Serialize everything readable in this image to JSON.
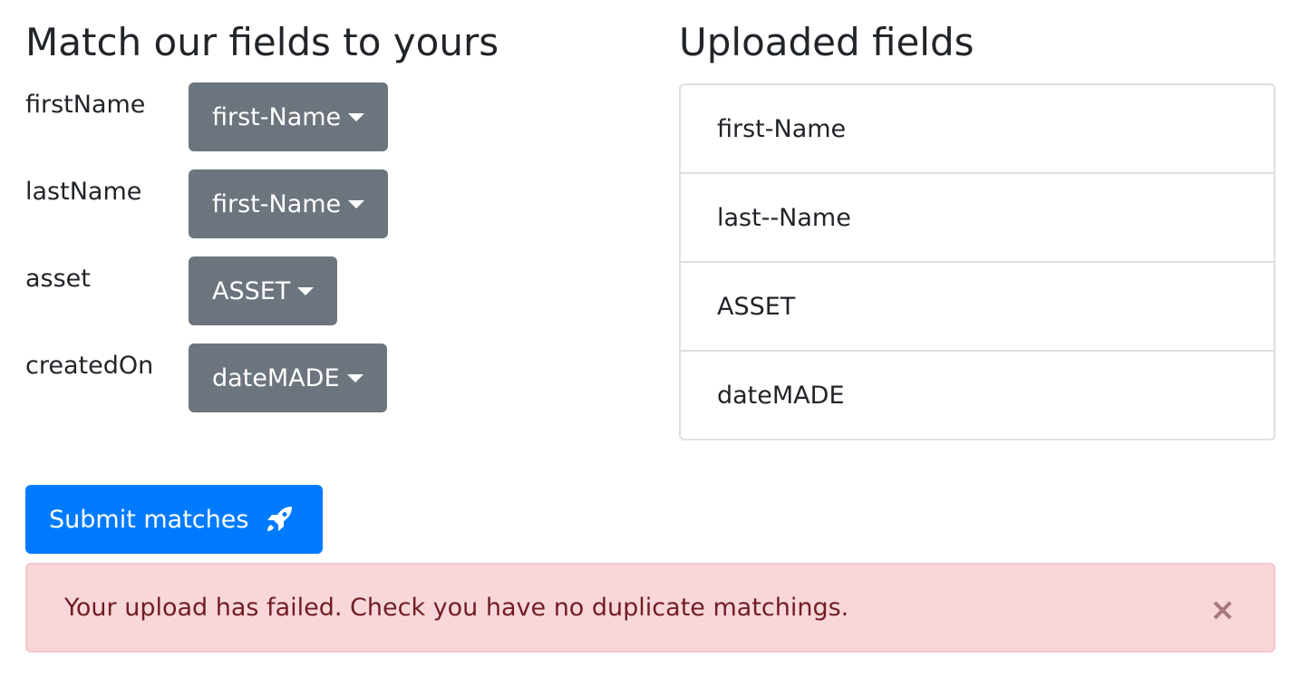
{
  "left": {
    "title": "Match our fields to yours",
    "rows": [
      {
        "label": "firstName",
        "selected": "first-Name"
      },
      {
        "label": "lastName",
        "selected": "first-Name"
      },
      {
        "label": "asset",
        "selected": "ASSET"
      },
      {
        "label": "createdOn",
        "selected": "dateMADE"
      }
    ]
  },
  "right": {
    "title": "Uploaded fields",
    "items": [
      "first-Name",
      "last--Name",
      "ASSET",
      "dateMADE"
    ]
  },
  "submit": {
    "label": "Submit matches",
    "icon": "rocket-icon"
  },
  "alert": {
    "message": "Your upload has failed. Check you have no duplicate matchings.",
    "close": "×"
  },
  "colors": {
    "primary": "#007bff",
    "secondary": "#6c757d",
    "danger_bg": "#f8d7da",
    "danger_text": "#721c24"
  }
}
